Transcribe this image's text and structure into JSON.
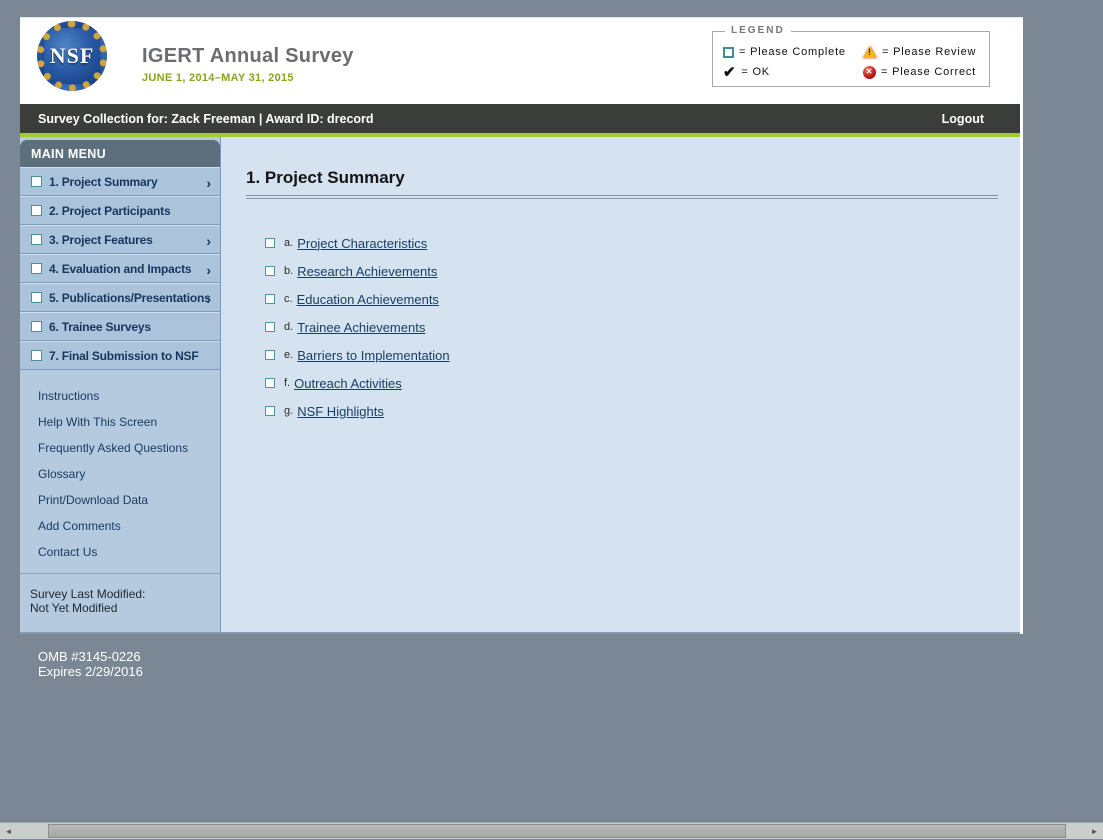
{
  "header": {
    "logo_text": "NSF",
    "title": "IGERT Annual Survey",
    "subtitle": "JUNE 1, 2014–MAY 31, 2015",
    "legend": {
      "label": "LEGEND",
      "items": [
        {
          "icon": "checkbox-icon",
          "text": "= Please Complete"
        },
        {
          "icon": "warning-icon",
          "text": "= Please Review"
        },
        {
          "icon": "check-icon",
          "text": "= OK"
        },
        {
          "icon": "error-icon",
          "text": "= Please Correct"
        }
      ]
    }
  },
  "toolbar": {
    "collection_text": "Survey Collection for: Zack Freeman | Award ID: drecord",
    "logout_label": "Logout"
  },
  "sidebar": {
    "menu_title": "MAIN MENU",
    "menu_items": [
      {
        "label": "1. Project Summary",
        "has_submenu": true
      },
      {
        "label": "2. Project Participants",
        "has_submenu": false
      },
      {
        "label": "3. Project Features",
        "has_submenu": true
      },
      {
        "label": "4. Evaluation and Impacts",
        "has_submenu": true
      },
      {
        "label": "5. Publications/Presentations",
        "has_submenu": true
      },
      {
        "label": "6. Trainee Surveys",
        "has_submenu": false
      },
      {
        "label": "7. Final Submission to NSF",
        "has_submenu": false
      }
    ],
    "links": [
      "Instructions",
      "Help With This Screen",
      "Frequently Asked Questions",
      "Glossary",
      "Print/Download Data",
      "Add Comments",
      "Contact Us"
    ],
    "last_modified_label": "Survey Last Modified:",
    "last_modified_value": "Not Yet Modified"
  },
  "main": {
    "heading": "1. Project Summary",
    "links": [
      {
        "letter": "a.",
        "label": "Project Characteristics"
      },
      {
        "letter": "b.",
        "label": "Research Achievements"
      },
      {
        "letter": "c.",
        "label": "Education Achievements"
      },
      {
        "letter": "d.",
        "label": "Trainee Achievements"
      },
      {
        "letter": "e.",
        "label": "Barriers to Implementation"
      },
      {
        "letter": "f.",
        "label": "Outreach Activities"
      },
      {
        "letter": "g.",
        "label": "NSF Highlights"
      }
    ]
  },
  "footer": {
    "omb_number": "OMB #3145-0226",
    "expires": "Expires 2/29/2016"
  },
  "icons": {
    "chevron": "›",
    "check": "✔",
    "warning_exclaim": "!",
    "error_x": "✕",
    "scroll_left": "◄",
    "scroll_right": "►"
  },
  "colors": {
    "accent_green": "#a5c72f",
    "toolbar_dark": "#3a3d3a",
    "sidebar_blue": "#b5cade",
    "content_blue": "#d4e3ef",
    "link_navy": "#1c3e63",
    "legend_teal": "#3d8e96",
    "subtitle_green": "#87a41d"
  }
}
